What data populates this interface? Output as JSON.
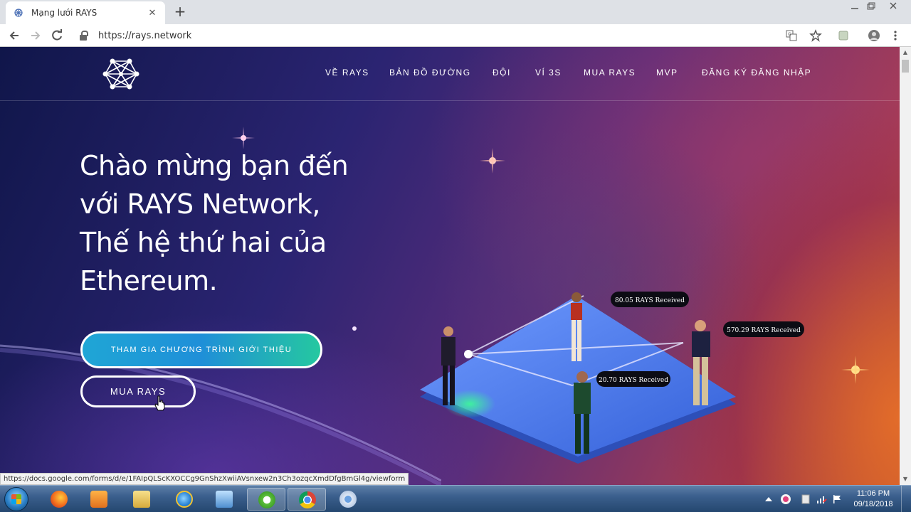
{
  "browser": {
    "tab_title": "Mạng lưới RAYS",
    "tab_close": "✕",
    "new_tab": "+",
    "url": "https://rays.network",
    "status_url": "https://docs.google.com/forms/d/e/1FAIpQLScKXOCCg9GnShzXwiiAVsnxew2n3Ch3ozqcXmdDfgBmGl4g/viewform"
  },
  "site": {
    "nav": [
      "VỀ RAYS",
      "BẢN ĐỒ ĐƯỜNG",
      "ĐỘI",
      "VÍ 3S",
      "MUA RAYS",
      "MVP",
      "ĐĂNG KÝ ĐĂNG NHẬP"
    ],
    "hero_lines": [
      "Chào mừng bạn đến",
      "với RAYS Network,",
      "Thế hệ thứ hai của",
      "Ethereum."
    ],
    "btn_join": "THAM GIA CHƯƠNG TRÌNH GIỚI THIỆU",
    "btn_buy": "MUA RAYS",
    "illustration_labels": [
      "80.05 RAYS Received",
      "570.29 RAYS Received",
      "20.70 RAYS Received"
    ]
  },
  "taskbar": {
    "time": "11:06 PM",
    "date": "09/18/2018"
  },
  "colors": {
    "primary_gradient_start": "#1fa6d6",
    "primary_gradient_end": "#25c8a0",
    "platform": "#3f7ee8"
  }
}
